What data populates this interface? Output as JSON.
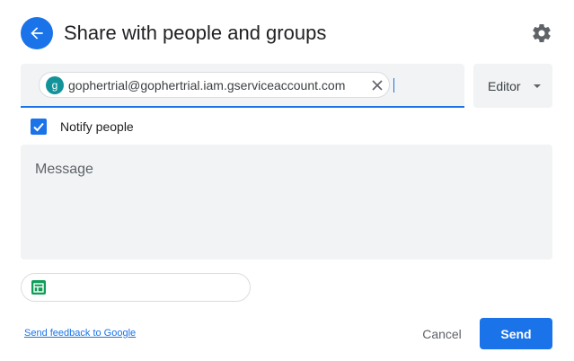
{
  "header": {
    "title": "Share with people and groups",
    "back_icon": "arrow-left-icon",
    "settings_icon": "gear-icon"
  },
  "recipients": {
    "chips": [
      {
        "avatar_letter": "g",
        "email": "gophertrial@gophertrial.iam.gserviceaccount.com",
        "avatar_color": "#12939a"
      }
    ]
  },
  "role": {
    "selected": "Editor"
  },
  "notify": {
    "label": "Notify people",
    "checked": true
  },
  "message": {
    "placeholder": "Message"
  },
  "attachment": {
    "icon": "google-sheets-icon"
  },
  "footer": {
    "feedback_link": "Send feedback to Google",
    "cancel_label": "Cancel",
    "send_label": "Send"
  },
  "colors": {
    "accent": "#1a73e8",
    "field_bg": "#f1f3f4",
    "sheets_green": "#0f9d58"
  }
}
